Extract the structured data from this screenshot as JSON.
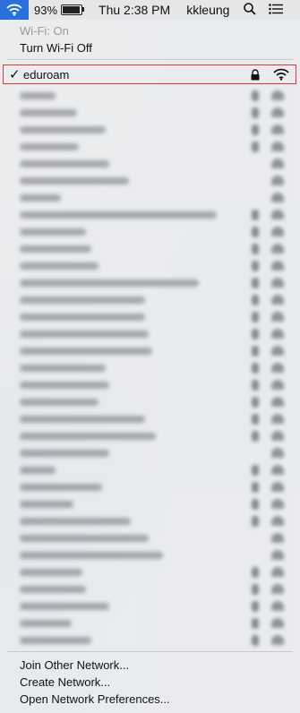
{
  "menubar": {
    "battery_percent": "93%",
    "battery_level": 0.93,
    "clock": "Thu 2:38 PM",
    "user": "kkleung"
  },
  "menu": {
    "wifi_status": "Wi-Fi: On",
    "toggle_wifi": "Turn Wi-Fi Off",
    "connected": {
      "check": "✓",
      "ssid": "eduroam"
    },
    "other_networks": [
      {
        "lock": true
      },
      {
        "lock": true
      },
      {
        "lock": true
      },
      {
        "lock": true
      },
      {
        "lock": false
      },
      {
        "lock": false
      },
      {
        "lock": false
      },
      {
        "lock": true
      },
      {
        "lock": true
      },
      {
        "lock": true
      },
      {
        "lock": true
      },
      {
        "lock": true
      },
      {
        "lock": true
      },
      {
        "lock": true
      },
      {
        "lock": true
      },
      {
        "lock": true
      },
      {
        "lock": true
      },
      {
        "lock": true
      },
      {
        "lock": true
      },
      {
        "lock": true
      },
      {
        "lock": true
      },
      {
        "lock": false
      },
      {
        "lock": true
      },
      {
        "lock": true
      },
      {
        "lock": true
      },
      {
        "lock": true
      },
      {
        "lock": false
      },
      {
        "lock": false
      },
      {
        "lock": true
      },
      {
        "lock": true
      },
      {
        "lock": true
      },
      {
        "lock": true
      },
      {
        "lock": true
      }
    ],
    "join_other": "Join Other Network...",
    "create_network": "Create Network...",
    "open_prefs": "Open Network Preferences..."
  }
}
